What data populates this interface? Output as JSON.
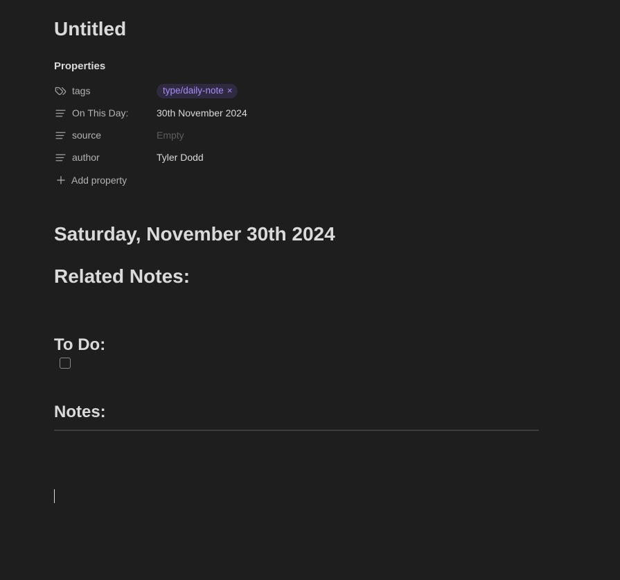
{
  "note": {
    "title": "Untitled"
  },
  "properties": {
    "heading": "Properties",
    "items": [
      {
        "icon": "tags-icon",
        "key": "tags",
        "type": "tag",
        "value": "type/daily-note"
      },
      {
        "icon": "text-lines-icon",
        "key": "On This Day:",
        "type": "text",
        "value": "30th November 2024"
      },
      {
        "icon": "text-lines-icon",
        "key": "source",
        "type": "empty",
        "value": "Empty"
      },
      {
        "icon": "text-lines-icon",
        "key": "author",
        "type": "text",
        "value": "Tyler Dodd"
      }
    ],
    "add_label": "Add property",
    "tag_remove_glyph": "×"
  },
  "content": {
    "date_heading": "Saturday, November 30th 2024",
    "related_heading": "Related Notes:",
    "todo_heading": "To Do:",
    "notes_heading": "Notes:"
  },
  "colors": {
    "background": "#1e1e1e",
    "text": "#dadada",
    "muted": "#b3b3b3",
    "tag_bg": "#2f2a40",
    "tag_text": "#a88bfa"
  }
}
